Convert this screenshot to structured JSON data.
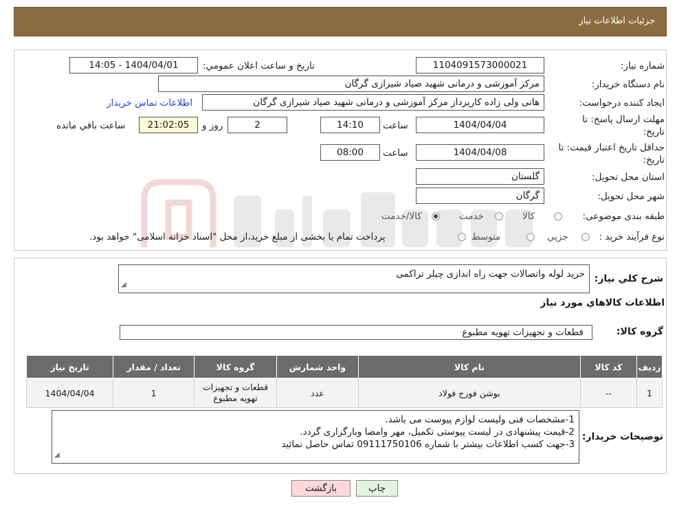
{
  "header": {
    "title": "جزئیات اطلاعات نیاز"
  },
  "form": {
    "need_number": {
      "label": "شماره نیاز:",
      "value": "1104091573000021"
    },
    "announce_datetime": {
      "label": "تاریخ و ساعت اعلان عمومي:",
      "value": "1404/04/01 - 14:05"
    },
    "buyer_org": {
      "label": "نام دستگاه خريدار:",
      "value": "مرکز آموزشی و درمانی شهید صیاد شیرازی گرگان"
    },
    "requester": {
      "label": "ايجاد کننده درخواست:",
      "value": "هانی ولی زاده کارپرداز مرکز آموزشی و درمانی شهید صیاد شیرازی گرگان",
      "contact_link": "اطلاعات تماس خريدار"
    },
    "reply_deadline": {
      "label": "مهلت ارسال پاسخ: تا تاریخ:",
      "date": "1404/04/04",
      "time_label": "ساعت",
      "time": "14:10",
      "days": "2",
      "days_label": "روز و",
      "remaining": "21:02:05",
      "remaining_label": "ساعت باقي مانده"
    },
    "price_validity": {
      "label": "حداقل تاریخ اعتبار قیمت: تا تاریخ:",
      "date": "1404/04/08",
      "time_label": "ساعت",
      "time": "08:00"
    },
    "province": {
      "label": "استان محل تحويل:",
      "value": "گلستان"
    },
    "city": {
      "label": "شهر محل تحويل:",
      "value": "گرگان"
    },
    "category": {
      "label": "طبقه بندی موضوعی:",
      "options": [
        "کالا",
        "خدمت",
        "کالا/خدمت"
      ]
    },
    "process": {
      "label": "نوع فرآيند خريد :",
      "options": [
        "جزيي",
        "متوسط"
      ],
      "note": "پرداخت تمام یا بخشی از مبلغ خرید،از محل \"اسناد خزانه اسلامی\" خواهد بود."
    }
  },
  "summary": {
    "label": "شرح کلي نياز:",
    "value": "خرید لوله واتصالات جهت راه اندازی چیلر تراکمی",
    "items_title": "اطلاعات کالاهاي مورد نياز",
    "group_label": "گروه کالا:",
    "group_value": "قطعات و تجهیزات تهویه مطبوع"
  },
  "table": {
    "headers": [
      "رديف",
      "کد کالا",
      "نام کالا",
      "واحد شمارش",
      "گروه کالا",
      "تعداد / مقدار",
      "تاريخ نياز"
    ],
    "rows": [
      [
        "1",
        "--",
        "بوشن فورج فولاد",
        "عدد",
        "قطعات و تجهیزات تهویه مطبوع",
        "1",
        "1404/04/04"
      ]
    ]
  },
  "buyer_notes": {
    "label": "توضيحات خريدار:",
    "lines": [
      "1-مشخصات فنی ولیست لوازم پیوست می باشد.",
      "2-قیمت پیشنهادی در لیست پیوستی تکمیل، مهر وامضا وبارگزاری گردد.",
      "3-جهت کسب اطلاعات بیشتر با شماره 09111750106 تماس حاصل نمائید"
    ]
  },
  "buttons": {
    "print": "چاپ",
    "back": "بازگشت"
  },
  "colors": {
    "header_bg": "#8a6c43",
    "table_header_bg": "#6b6b6b",
    "back_button_bg": "#ffd9d9",
    "print_button_bg": "#e3f5e0",
    "link": "#2a3fd1"
  }
}
